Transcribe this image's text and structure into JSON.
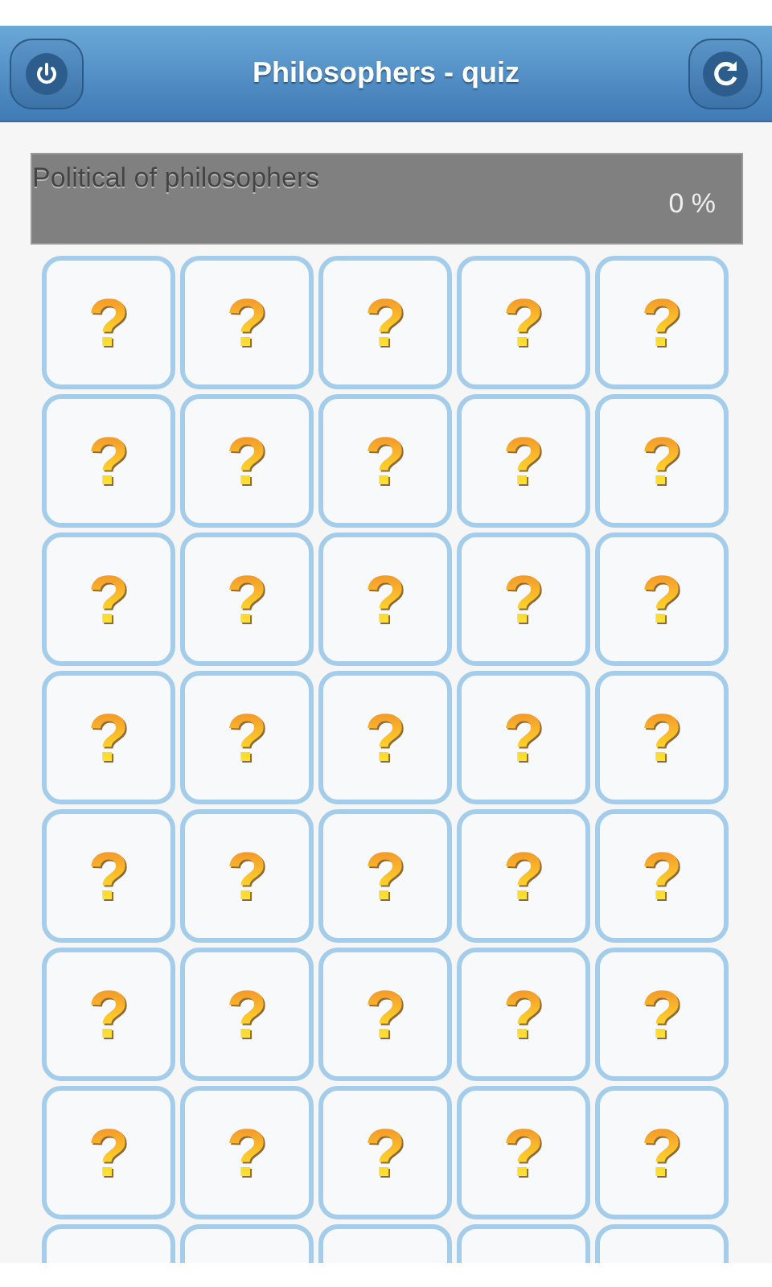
{
  "header": {
    "title": "Philosophers - quiz"
  },
  "progress": {
    "label": "Political of philosophers",
    "reading": "0 %"
  },
  "cards": [
    {
      "kind": "question",
      "label": "?"
    },
    {
      "kind": "question",
      "label": "?"
    },
    {
      "kind": "question",
      "label": "?"
    },
    {
      "kind": "question",
      "label": "?"
    },
    {
      "kind": "question",
      "label": "?"
    },
    {
      "kind": "question",
      "label": "?"
    },
    {
      "kind": "question",
      "label": "?"
    },
    {
      "kind": "question",
      "label": "?"
    },
    {
      "kind": "question",
      "label": "?"
    },
    {
      "kind": "question",
      "label": "?"
    },
    {
      "kind": "question",
      "label": "?"
    },
    {
      "kind": "question",
      "label": "?"
    },
    {
      "kind": "question",
      "label": "?"
    },
    {
      "kind": "question",
      "label": "?"
    },
    {
      "kind": "question",
      "label": "?"
    },
    {
      "kind": "question",
      "label": "?"
    },
    {
      "kind": "question",
      "label": "?"
    },
    {
      "kind": "question",
      "label": "?"
    },
    {
      "kind": "question",
      "label": "?"
    },
    {
      "kind": "question",
      "label": "?"
    },
    {
      "kind": "question",
      "label": "?"
    },
    {
      "kind": "question",
      "label": "?"
    },
    {
      "kind": "question",
      "label": "?"
    },
    {
      "kind": "question",
      "label": "?"
    },
    {
      "kind": "question",
      "label": "?"
    },
    {
      "kind": "question",
      "label": "?"
    },
    {
      "kind": "question",
      "label": "?"
    },
    {
      "kind": "question",
      "label": "?"
    },
    {
      "kind": "question",
      "label": "?"
    },
    {
      "kind": "question",
      "label": "?"
    },
    {
      "kind": "question",
      "label": "?"
    },
    {
      "kind": "question",
      "label": "?"
    },
    {
      "kind": "question",
      "label": "?"
    },
    {
      "kind": "question",
      "label": "?"
    },
    {
      "kind": "question",
      "label": "?"
    },
    {
      "kind": "cut"
    },
    {
      "kind": "cut"
    },
    {
      "kind": "cut"
    },
    {
      "kind": "cut"
    },
    {
      "kind": "cut"
    }
  ]
}
